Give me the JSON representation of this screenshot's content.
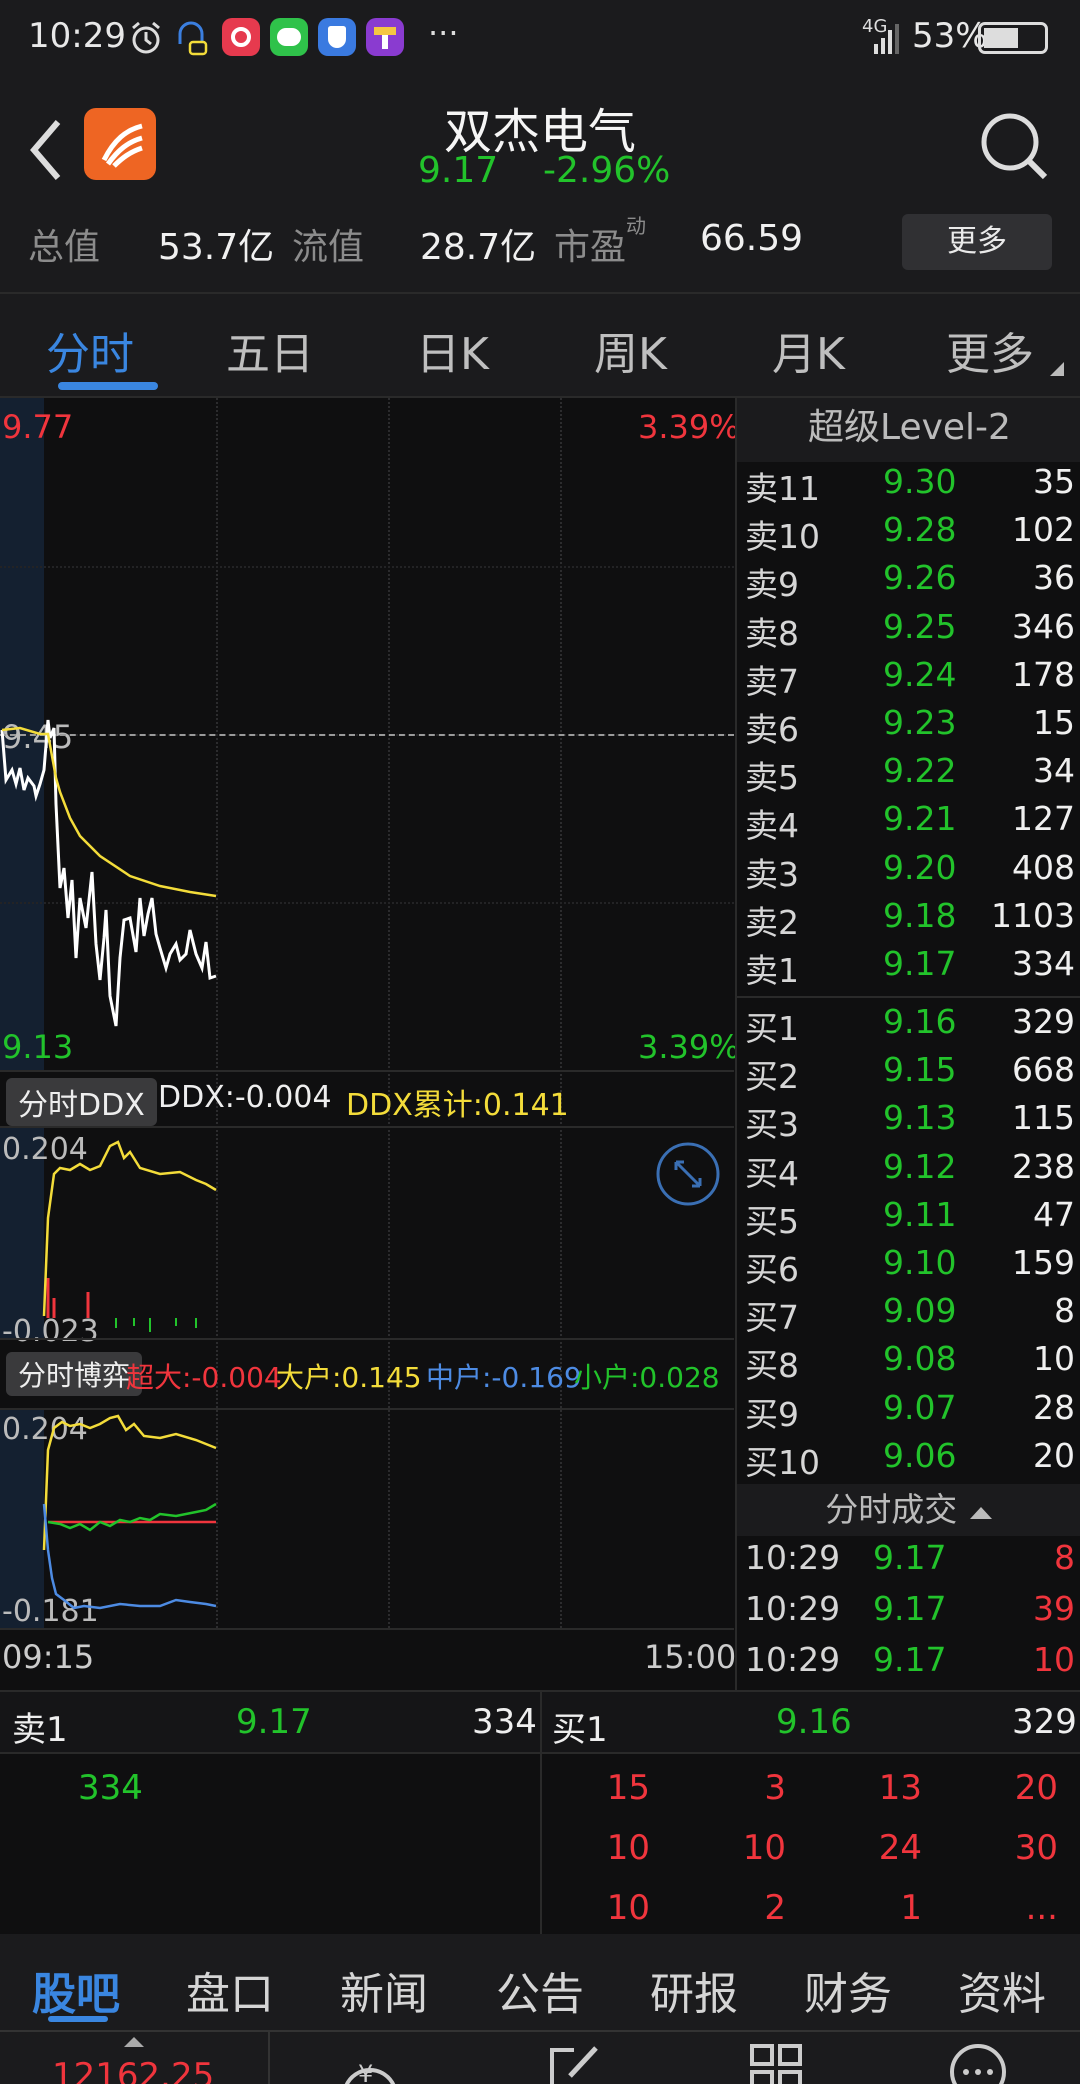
{
  "status_bar": {
    "time": "10:29",
    "more": "···",
    "network": "4G",
    "battery": "53%"
  },
  "header": {
    "name": "双杰电气",
    "price": "9.17",
    "change_pct": "-2.96%",
    "metrics": [
      {
        "label": "总值",
        "value": "53.7亿"
      },
      {
        "label": "流值",
        "value": "28.7亿"
      },
      {
        "label": "市盈",
        "sup": "动",
        "value": "66.59"
      }
    ],
    "more_button": "更多"
  },
  "tabs": [
    "分时",
    "五日",
    "日K",
    "周K",
    "月K",
    "更多"
  ],
  "chart": {
    "price_high": "9.77",
    "price_low": "9.13",
    "pct_high": "3.39%",
    "pct_low": "3.39%",
    "prev_close": "9.45",
    "ddx_tag": "分时DDX",
    "ddx_value": "DDX:-0.004",
    "ddx_cum": "DDX累计:0.141",
    "ddx_max": "0.204",
    "ddx_min": "-0.023",
    "game_tag": "分时博弈",
    "game_super": "超大:-0.004",
    "game_large": "大户:0.145",
    "game_mid": "中户:-0.169",
    "game_small": "小户:0.028",
    "game_max": "0.204",
    "game_min": "-0.181",
    "time_start": "09:15",
    "time_end": "15:00",
    "colors": {
      "price_line": "#ffffff",
      "avg_line": "#f3dc3a",
      "up": "#f0353d",
      "down": "#22c32b",
      "mid": "#4d8be3"
    }
  },
  "orderbook": {
    "title": "超级Level-2",
    "asks": [
      {
        "label": "卖11",
        "price": "9.30",
        "vol": "35"
      },
      {
        "label": "卖10",
        "price": "9.28",
        "vol": "102"
      },
      {
        "label": "卖9",
        "price": "9.26",
        "vol": "36"
      },
      {
        "label": "卖8",
        "price": "9.25",
        "vol": "346"
      },
      {
        "label": "卖7",
        "price": "9.24",
        "vol": "178"
      },
      {
        "label": "卖6",
        "price": "9.23",
        "vol": "15"
      },
      {
        "label": "卖5",
        "price": "9.22",
        "vol": "34"
      },
      {
        "label": "卖4",
        "price": "9.21",
        "vol": "127"
      },
      {
        "label": "卖3",
        "price": "9.20",
        "vol": "408"
      },
      {
        "label": "卖2",
        "price": "9.18",
        "vol": "1103"
      },
      {
        "label": "卖1",
        "price": "9.17",
        "vol": "334"
      }
    ],
    "bids": [
      {
        "label": "买1",
        "price": "9.16",
        "vol": "329"
      },
      {
        "label": "买2",
        "price": "9.15",
        "vol": "668"
      },
      {
        "label": "买3",
        "price": "9.13",
        "vol": "115"
      },
      {
        "label": "买4",
        "price": "9.12",
        "vol": "238"
      },
      {
        "label": "买5",
        "price": "9.11",
        "vol": "47"
      },
      {
        "label": "买6",
        "price": "9.10",
        "vol": "159"
      },
      {
        "label": "买7",
        "price": "9.09",
        "vol": "8"
      },
      {
        "label": "买8",
        "price": "9.08",
        "vol": "10"
      },
      {
        "label": "买9",
        "price": "9.07",
        "vol": "28"
      },
      {
        "label": "买10",
        "price": "9.06",
        "vol": "20"
      }
    ],
    "ticks_title": "分时成交",
    "ticks": [
      {
        "time": "10:29",
        "price": "9.17",
        "vol": "8"
      },
      {
        "time": "10:29",
        "price": "9.17",
        "vol": "39"
      },
      {
        "time": "10:29",
        "price": "9.17",
        "vol": "10"
      }
    ]
  },
  "queue": {
    "sell_label": "卖1",
    "sell_price": "9.17",
    "sell_vol": "334",
    "sell_orders": [
      "334"
    ],
    "buy_label": "买1",
    "buy_price": "9.16",
    "buy_vol": "329",
    "buy_orders": [
      "15",
      "3",
      "13",
      "20",
      "10",
      "10",
      "24",
      "30",
      "10",
      "2",
      "1",
      "..."
    ]
  },
  "bottom_tabs": [
    "股吧",
    "盘口",
    "新闻",
    "公告",
    "研报",
    "财务",
    "资料"
  ],
  "nav": {
    "index_value": "12162.25",
    "icons": [
      "yuan-refresh-icon",
      "edit-icon",
      "grid-icon",
      "chat-more-icon"
    ]
  }
}
